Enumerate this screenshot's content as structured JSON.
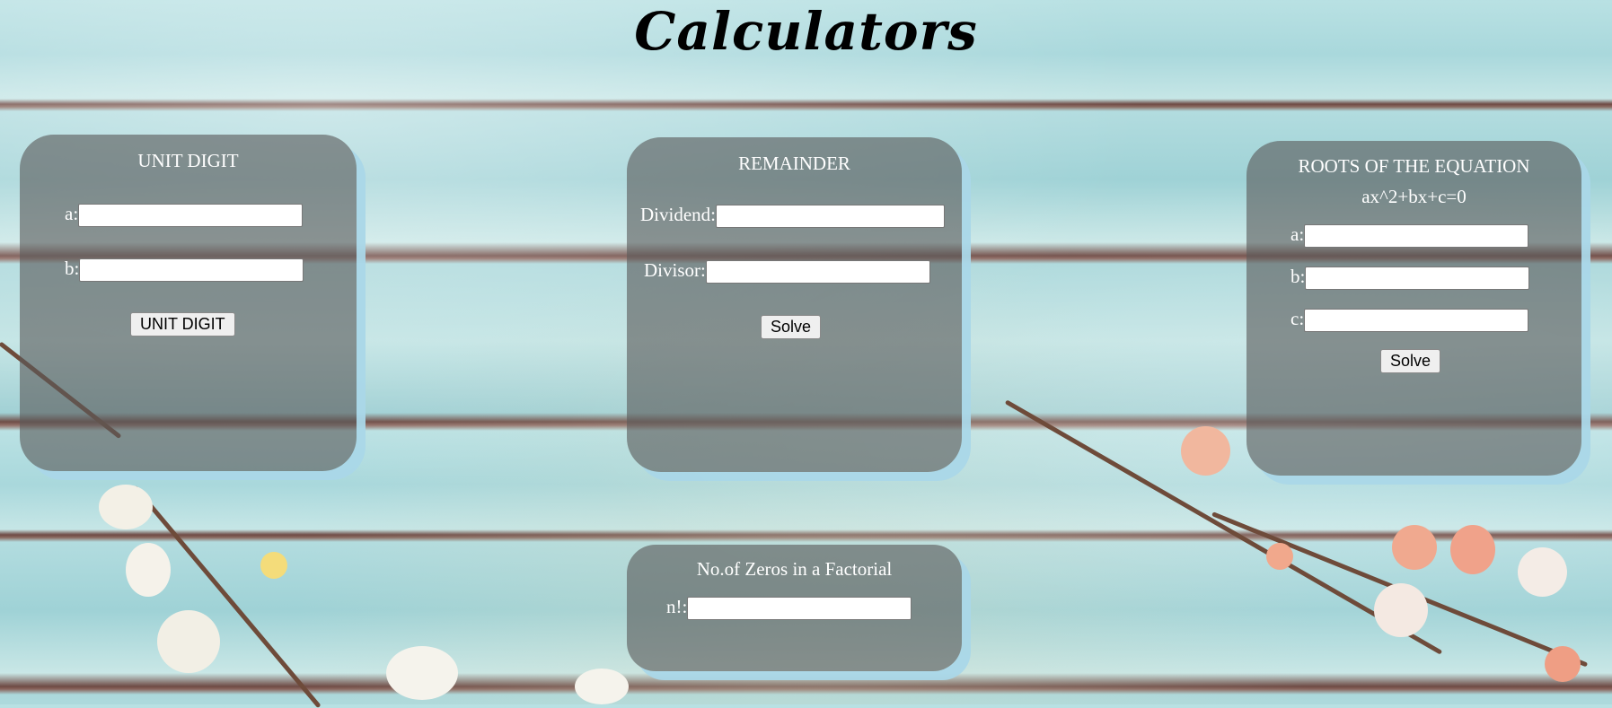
{
  "page": {
    "title": "Calculators"
  },
  "unit_digit": {
    "heading": "UNIT DIGIT",
    "a_label": "a:",
    "b_label": "b:",
    "a_value": "",
    "b_value": "",
    "button_label": "UNIT DIGIT"
  },
  "remainder": {
    "heading": "REMAINDER",
    "dividend_label": "Dividend:",
    "divisor_label": "Divisor:",
    "dividend_value": "",
    "divisor_value": "",
    "button_label": "Solve"
  },
  "roots": {
    "heading": "ROOTS OF THE EQUATION",
    "equation": "ax^2+bx+c=0",
    "a_label": "a:",
    "b_label": "b:",
    "c_label": "c:",
    "a_value": "",
    "b_value": "",
    "c_value": "",
    "button_label": "Solve"
  },
  "factorial_zeros": {
    "heading": "No.of Zeros in a Factorial",
    "n_label": "n!:",
    "n_value": ""
  },
  "colors": {
    "card_bg": "#5a5a5a",
    "card_shadow": "#aad7e8",
    "wood": "#b2dcdf"
  }
}
